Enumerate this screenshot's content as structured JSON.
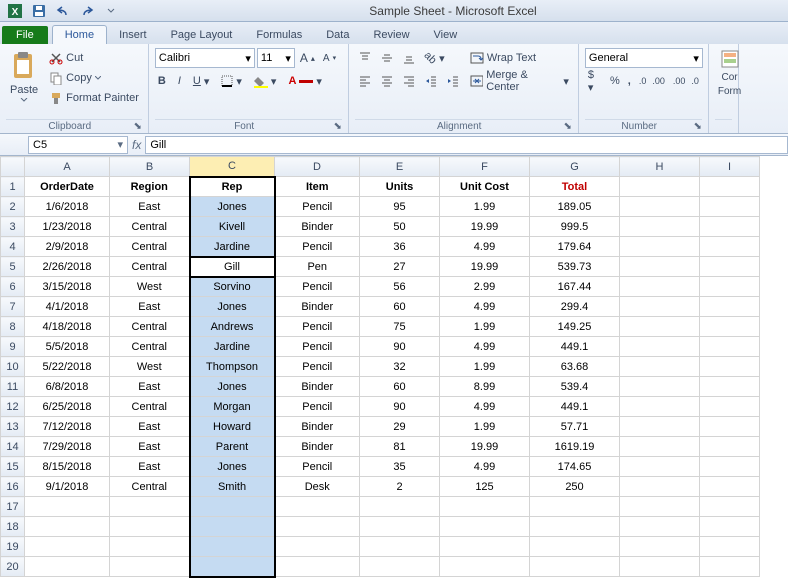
{
  "title": "Sample Sheet - Microsoft Excel",
  "tabs": {
    "file": "File",
    "home": "Home",
    "insert": "Insert",
    "pagelayout": "Page Layout",
    "formulas": "Formulas",
    "data": "Data",
    "review": "Review",
    "view": "View"
  },
  "clipboard": {
    "paste": "Paste",
    "cut": "Cut",
    "copy": "Copy",
    "painter": "Format Painter",
    "label": "Clipboard"
  },
  "font": {
    "name": "Calibri",
    "size": "11",
    "label": "Font"
  },
  "alignment": {
    "wrap": "Wrap Text",
    "merge": "Merge & Center",
    "label": "Alignment"
  },
  "number": {
    "format": "General",
    "label": "Number",
    "cor": "Cor",
    "form": "Form"
  },
  "namebox": "C5",
  "formula": "Gill",
  "columns": [
    "A",
    "B",
    "C",
    "D",
    "E",
    "F",
    "G",
    "H",
    "I"
  ],
  "header": {
    "A": "OrderDate",
    "B": "Region",
    "C": "Rep",
    "D": "Item",
    "E": "Units",
    "F": "Unit Cost",
    "G": "Total"
  },
  "rows": [
    {
      "A": "1/6/2018",
      "B": "East",
      "C": "Jones",
      "D": "Pencil",
      "E": "95",
      "F": "1.99",
      "G": "189.05"
    },
    {
      "A": "1/23/2018",
      "B": "Central",
      "C": "Kivell",
      "D": "Binder",
      "E": "50",
      "F": "19.99",
      "G": "999.5"
    },
    {
      "A": "2/9/2018",
      "B": "Central",
      "C": "Jardine",
      "D": "Pencil",
      "E": "36",
      "F": "4.99",
      "G": "179.64"
    },
    {
      "A": "2/26/2018",
      "B": "Central",
      "C": "Gill",
      "D": "Pen",
      "E": "27",
      "F": "19.99",
      "G": "539.73"
    },
    {
      "A": "3/15/2018",
      "B": "West",
      "C": "Sorvino",
      "D": "Pencil",
      "E": "56",
      "F": "2.99",
      "G": "167.44"
    },
    {
      "A": "4/1/2018",
      "B": "East",
      "C": "Jones",
      "D": "Binder",
      "E": "60",
      "F": "4.99",
      "G": "299.4"
    },
    {
      "A": "4/18/2018",
      "B": "Central",
      "C": "Andrews",
      "D": "Pencil",
      "E": "75",
      "F": "1.99",
      "G": "149.25"
    },
    {
      "A": "5/5/2018",
      "B": "Central",
      "C": "Jardine",
      "D": "Pencil",
      "E": "90",
      "F": "4.99",
      "G": "449.1"
    },
    {
      "A": "5/22/2018",
      "B": "West",
      "C": "Thompson",
      "D": "Pencil",
      "E": "32",
      "F": "1.99",
      "G": "63.68"
    },
    {
      "A": "6/8/2018",
      "B": "East",
      "C": "Jones",
      "D": "Binder",
      "E": "60",
      "F": "8.99",
      "G": "539.4"
    },
    {
      "A": "6/25/2018",
      "B": "Central",
      "C": "Morgan",
      "D": "Pencil",
      "E": "90",
      "F": "4.99",
      "G": "449.1"
    },
    {
      "A": "7/12/2018",
      "B": "East",
      "C": "Howard",
      "D": "Binder",
      "E": "29",
      "F": "1.99",
      "G": "57.71"
    },
    {
      "A": "7/29/2018",
      "B": "East",
      "C": "Parent",
      "D": "Binder",
      "E": "81",
      "F": "19.99",
      "G": "1619.19"
    },
    {
      "A": "8/15/2018",
      "B": "East",
      "C": "Jones",
      "D": "Pencil",
      "E": "35",
      "F": "4.99",
      "G": "174.65"
    },
    {
      "A": "9/1/2018",
      "B": "Central",
      "C": "Smith",
      "D": "Desk",
      "E": "2",
      "F": "125",
      "G": "250"
    }
  ],
  "blankRows": 4,
  "activeCell": {
    "row": 5,
    "col": "C"
  },
  "colWidths": {
    "row": 24,
    "A": 85,
    "B": 80,
    "C": 85,
    "D": 85,
    "E": 80,
    "F": 90,
    "G": 90,
    "H": 80,
    "I": 60
  }
}
